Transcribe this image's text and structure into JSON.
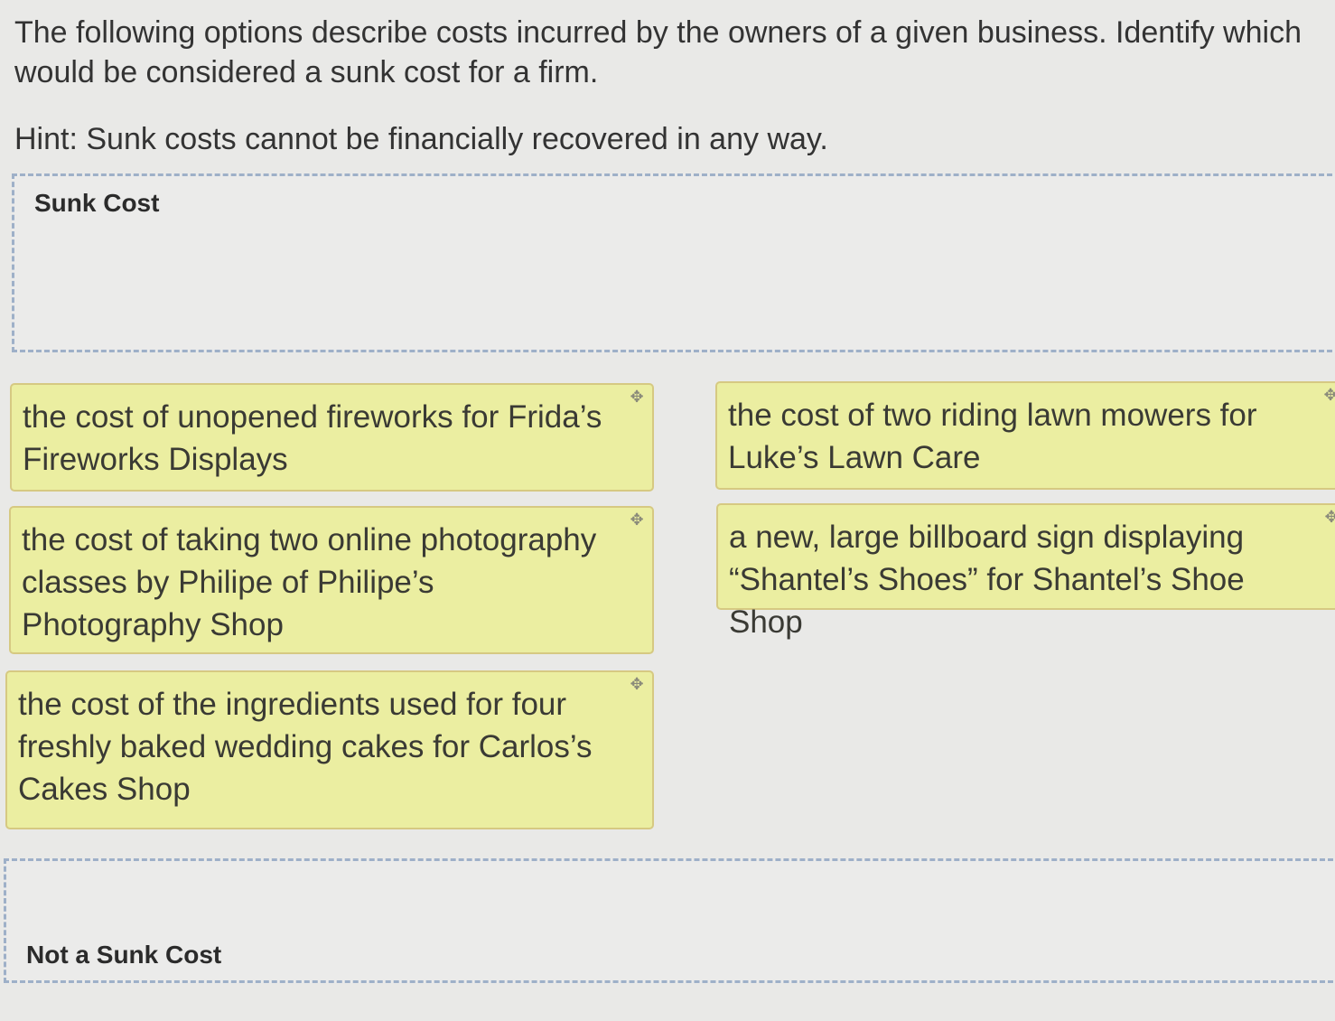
{
  "question": {
    "prompt": "The following options describe costs incurred by the owners of a given business. Identify which would be considered a sunk cost for a firm.",
    "hint": "Hint: Sunk costs cannot be financially recovered in any way."
  },
  "zones": {
    "sunk_cost_label": "Sunk Cost",
    "not_sunk_cost_label": "Not a Sunk Cost"
  },
  "cards": [
    {
      "text": "the cost of unopened fireworks for Frida’s Fireworks Displays",
      "icon": "drag-move-icon"
    },
    {
      "text": "the cost of two riding lawn mowers for Luke’s Lawn Care",
      "icon": "drag-move-icon"
    },
    {
      "text": "the cost of taking two online photography classes by Philipe of Philipe’s Photography Shop",
      "icon": "drag-move-icon"
    },
    {
      "text": "a new, large billboard sign displaying “Shantel’s Shoes” for Shantel’s Shoe Shop",
      "icon": "drag-move-icon"
    },
    {
      "text": "the cost of the ingredients used for four freshly baked wedding cakes for Carlos’s Cakes Shop",
      "icon": "drag-move-icon"
    }
  ],
  "colors": {
    "card_background": "#ebeea1",
    "card_border": "#d6c982",
    "dropzone_border": "#9eb0c8",
    "page_background": "#e9e9e7"
  }
}
